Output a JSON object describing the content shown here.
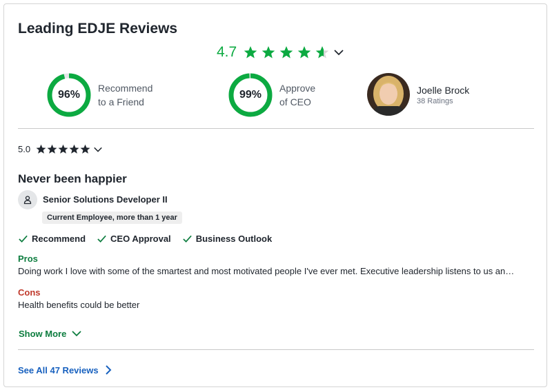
{
  "widget": {
    "title": "Leading EDJE Reviews",
    "overall_rating": "4.7",
    "overall_stars": 4.7,
    "colors": {
      "green": "#0caa41",
      "dark_green": "#0d7d3f",
      "link_blue": "#1861bf",
      "red": "#c0392b"
    }
  },
  "metrics": [
    {
      "percent": 0.96,
      "percent_label": "96%",
      "line1": "Recommend",
      "line2": "to a Friend"
    },
    {
      "percent": 0.99,
      "percent_label": "99%",
      "line1": "Approve",
      "line2": "of CEO"
    }
  ],
  "ceo": {
    "name": "Joelle Brock",
    "ratings": "38 Ratings"
  },
  "review": {
    "rating": "5.0",
    "stars": 5,
    "title": "Never been happier",
    "role": "Senior Solutions Developer II",
    "employment": "Current Employee, more than 1 year",
    "checks": [
      "Recommend",
      "CEO Approval",
      "Business Outlook"
    ],
    "pros_label": "Pros",
    "pros_text": "Doing work I love with some of the smartest and most motivated people I've ever met. Executive leadership listens to us and recognizes u…",
    "cons_label": "Cons",
    "cons_text": "Health benefits could be better",
    "show_more": "Show More"
  },
  "see_all": "See All 47 Reviews"
}
